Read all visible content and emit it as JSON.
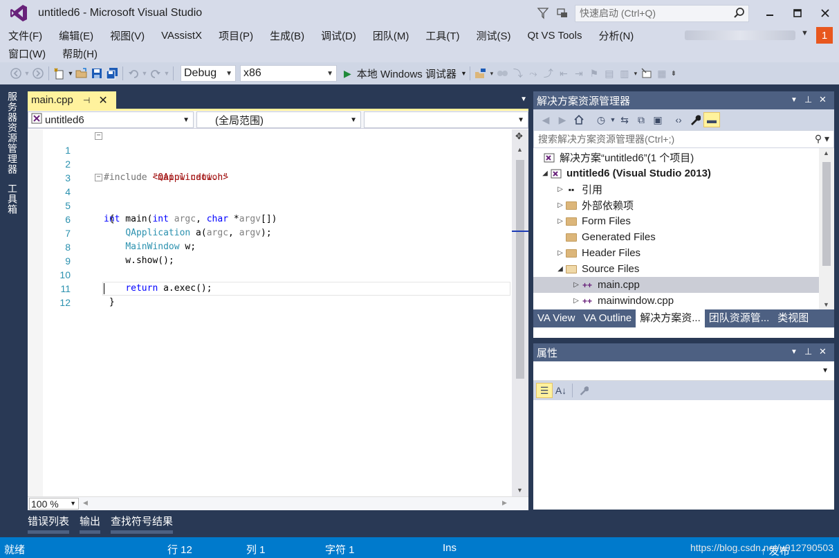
{
  "window": {
    "title": "untitled6 - Microsoft Visual Studio",
    "quick_launch_placeholder": "快速启动 (Ctrl+Q)",
    "notification_count": "1"
  },
  "menu": {
    "row1": [
      "文件(F)",
      "编辑(E)",
      "视图(V)",
      "VAssistX",
      "项目(P)",
      "生成(B)",
      "调试(D)",
      "团队(M)",
      "工具(T)",
      "测试(S)",
      "Qt VS Tools",
      "分析(N)"
    ],
    "row2": [
      "窗口(W)",
      "帮助(H)"
    ]
  },
  "toolbar": {
    "config": "Debug",
    "platform": "x86",
    "run_label": "本地 Windows 调试器"
  },
  "left_tabs": [
    "服务器资源管理器",
    "工具箱"
  ],
  "editor": {
    "tab_label": "main.cpp",
    "nav_project": "untitled6",
    "nav_scope": "(全局范围)",
    "zoom": "100 %",
    "lines": [
      "1",
      "2",
      "3",
      "4",
      "5",
      "6",
      "7",
      "8",
      "9",
      "10",
      "11",
      "12"
    ]
  },
  "solution_explorer": {
    "title": "解决方案资源管理器",
    "search_placeholder": "搜索解决方案资源管理器(Ctrl+;)",
    "solution": "解决方案“untitled6”(1 个项目)",
    "project": "untitled6 (Visual Studio 2013)",
    "items": [
      "引用",
      "外部依赖项",
      "Form Files",
      "Generated Files",
      "Header Files",
      "Source Files",
      "main.cpp",
      "mainwindow.cpp"
    ],
    "tabs": [
      "VA View",
      "VA Outline",
      "解决方案资...",
      "团队资源管...",
      "类视图"
    ]
  },
  "properties": {
    "title": "属性"
  },
  "bottom_tabs": [
    "错误列表",
    "输出",
    "查找符号结果"
  ],
  "status": {
    "ready": "就绪",
    "line": "行 12",
    "col": "列 1",
    "char": "字符 1",
    "mode": "Ins",
    "publish": "↑ 发布",
    "watermark": "https://blog.csdn.net/u012790503"
  }
}
